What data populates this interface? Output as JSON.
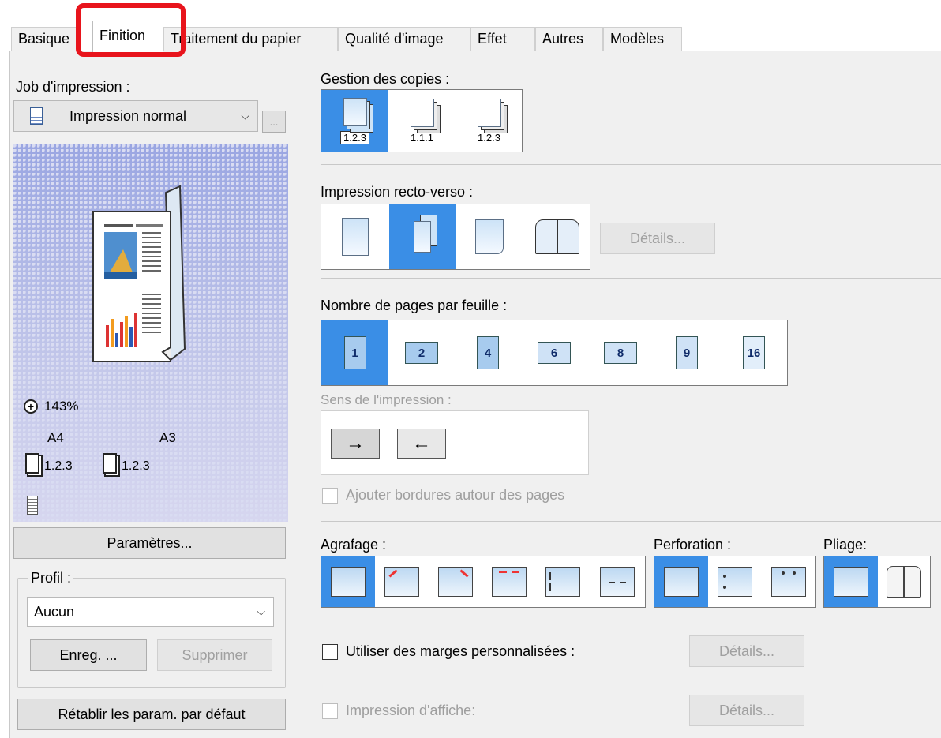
{
  "tabs": [
    "Basique",
    "Finition",
    "Traitement du papier",
    "Qualité d'image",
    "Effet",
    "Autres",
    "Modèles"
  ],
  "left": {
    "job_label": "Job d'impression :",
    "job_value": "Impression normal",
    "more_button": "...",
    "zoom_text": "143%",
    "paper_a": "A4",
    "paper_b": "A3",
    "stack_a": "1.2.3",
    "stack_b": "1.2.3",
    "params_button": "Paramètres...",
    "profile_label": "Profil :",
    "profile_value": "Aucun",
    "save_button": "Enreg. ...",
    "delete_button": "Supprimer",
    "reset_button": "Rétablir les param. par défaut"
  },
  "copies": {
    "label": "Gestion des copies :",
    "options": [
      "1.2.3",
      "1.1.1",
      "1.2.3"
    ]
  },
  "duplex": {
    "label": "Impression recto-verso :",
    "details_button": "Détails..."
  },
  "nup": {
    "label": "Nombre de pages par feuille :",
    "options": [
      "1",
      "2",
      "4",
      "6",
      "8",
      "9",
      "16"
    ],
    "direction_label": "Sens de l'impression :",
    "border_label": "Ajouter bordures autour des pages"
  },
  "staple": {
    "label": "Agrafage :"
  },
  "punch": {
    "label": "Perforation :"
  },
  "fold": {
    "label": "Pliage:"
  },
  "margins": {
    "label": "Utiliser des marges personnalisées :",
    "details_button": "Détails..."
  },
  "poster": {
    "label": "Impression d'affiche:",
    "details_button": "Détails..."
  },
  "colors": {
    "selected": "#3a8ee6",
    "highlight": "#e8141c"
  }
}
